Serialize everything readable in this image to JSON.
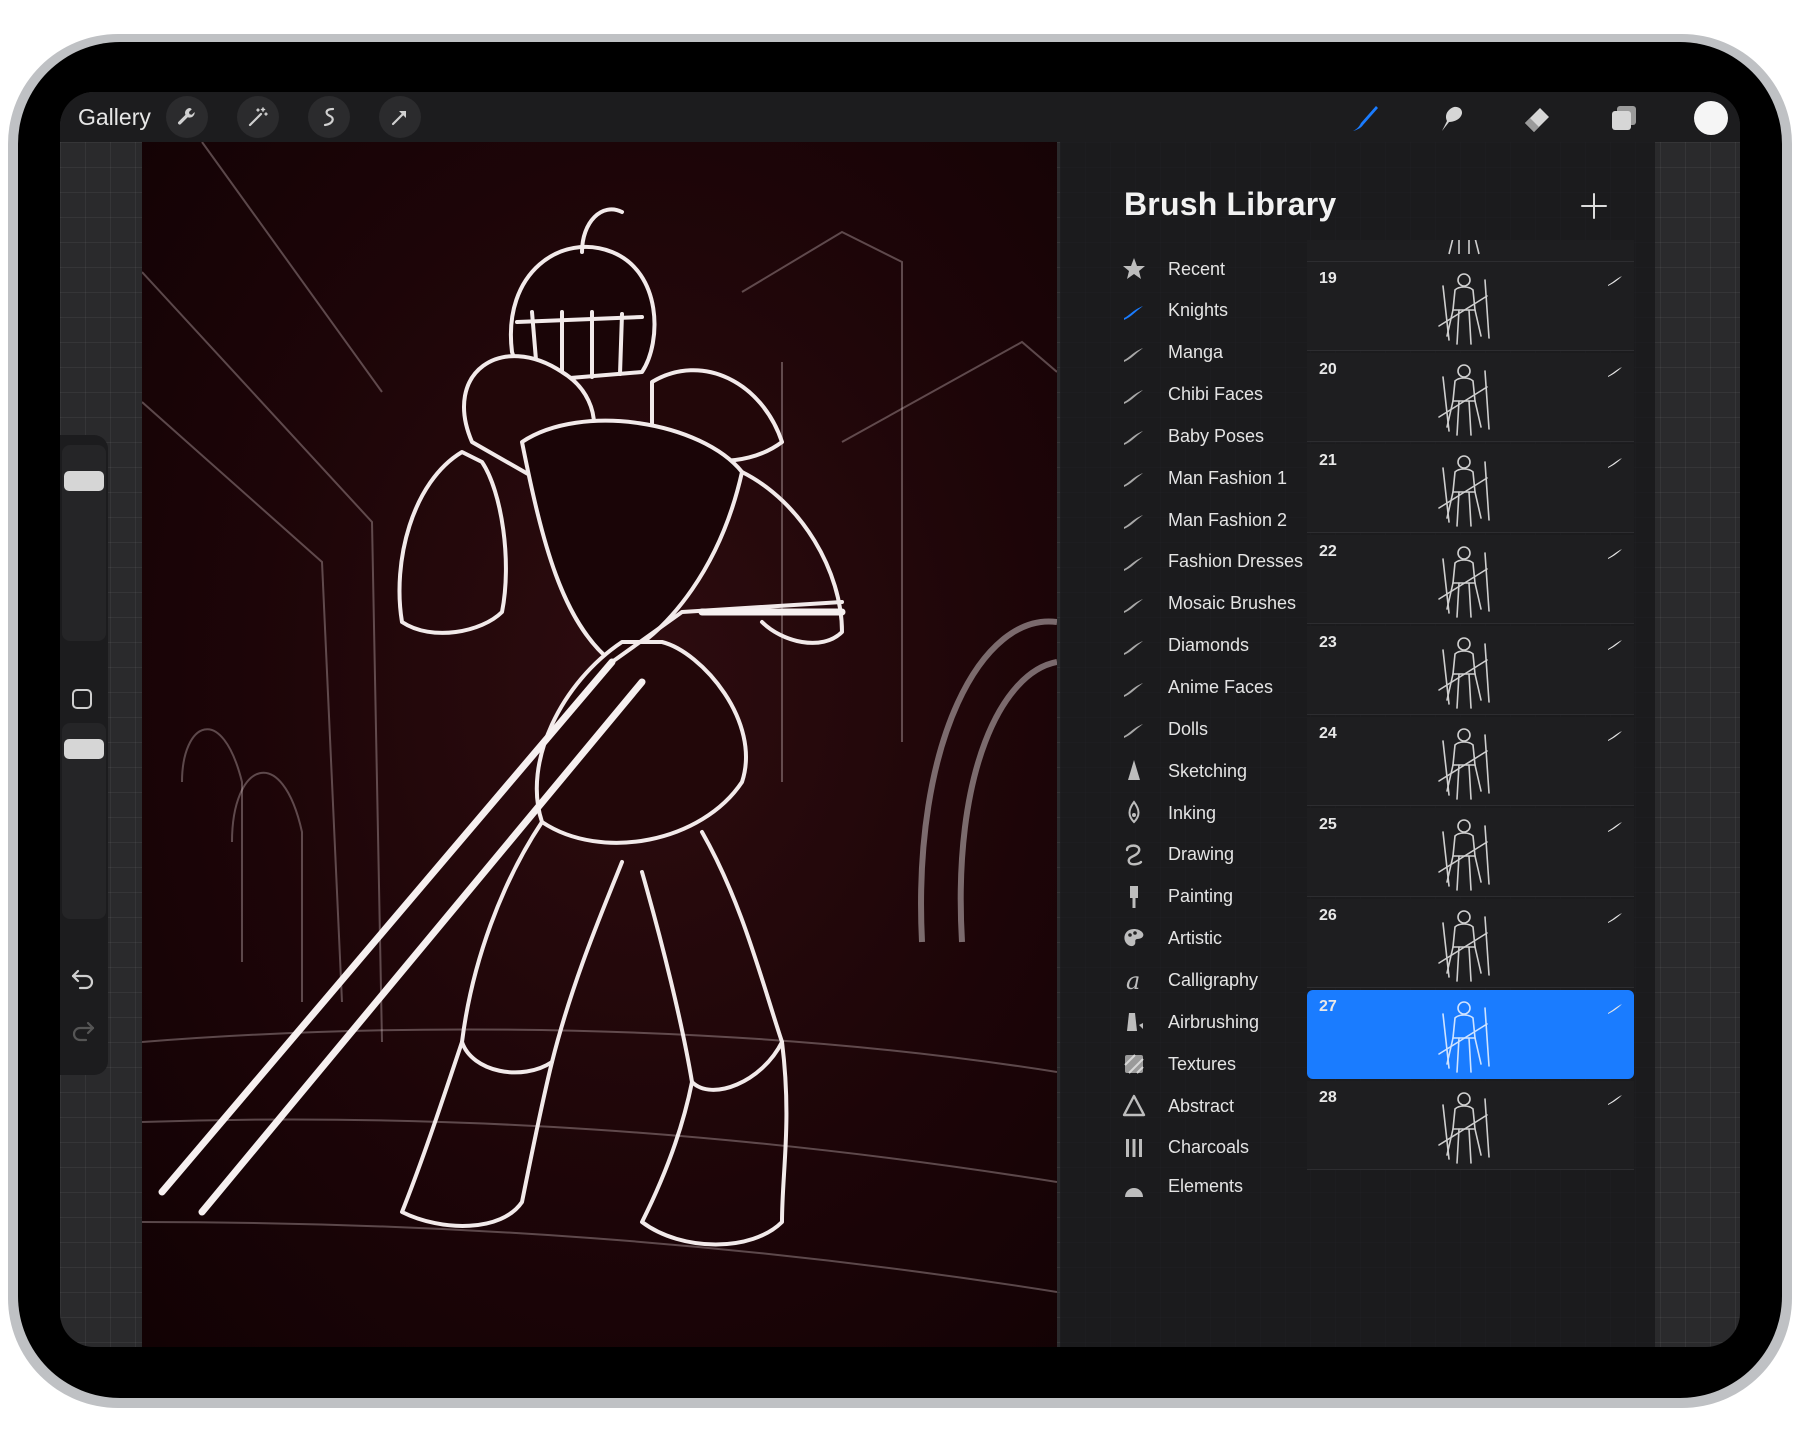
{
  "toolbar": {
    "gallery_label": "Gallery",
    "left_tools": [
      "wrench-icon",
      "magic-wand-icon",
      "selection-icon",
      "transform-arrow-icon"
    ],
    "right_tools": [
      "brush-icon",
      "smudge-icon",
      "eraser-icon",
      "layers-icon"
    ],
    "active_tool": "brush-icon",
    "current_color": "#f5f5f5",
    "accent_color": "#1a7cff"
  },
  "panel": {
    "title": "Brush Library",
    "categories": [
      {
        "label": "Recent",
        "icon": "star-icon"
      },
      {
        "label": "Knights",
        "icon": "stroke-icon"
      },
      {
        "label": "Manga",
        "icon": "stroke-icon"
      },
      {
        "label": "Chibi Faces",
        "icon": "stroke-icon"
      },
      {
        "label": "Baby Poses",
        "icon": "stroke-icon"
      },
      {
        "label": "Man Fashion 1",
        "icon": "stroke-icon"
      },
      {
        "label": "Man Fashion 2",
        "icon": "stroke-icon"
      },
      {
        "label": "Fashion Dresses",
        "icon": "stroke-icon"
      },
      {
        "label": "Mosaic Brushes",
        "icon": "stroke-icon"
      },
      {
        "label": "Diamonds",
        "icon": "stroke-icon"
      },
      {
        "label": "Anime Faces",
        "icon": "stroke-icon"
      },
      {
        "label": "Dolls",
        "icon": "stroke-icon"
      },
      {
        "label": "Sketching",
        "icon": "pencil-tip-icon"
      },
      {
        "label": "Inking",
        "icon": "ink-nib-icon"
      },
      {
        "label": "Drawing",
        "icon": "squiggle-icon"
      },
      {
        "label": "Painting",
        "icon": "paint-brush-icon"
      },
      {
        "label": "Artistic",
        "icon": "palette-icon"
      },
      {
        "label": "Calligraphy",
        "icon": "calligraphy-a-icon"
      },
      {
        "label": "Airbrushing",
        "icon": "airbrush-icon"
      },
      {
        "label": "Textures",
        "icon": "texture-icon"
      },
      {
        "label": "Abstract",
        "icon": "triangle-icon"
      },
      {
        "label": "Charcoals",
        "icon": "charcoal-icon"
      },
      {
        "label": "Elements",
        "icon": "element-icon"
      }
    ],
    "active_category": "Knights",
    "brushes": [
      {
        "num": "19"
      },
      {
        "num": "20"
      },
      {
        "num": "21"
      },
      {
        "num": "22"
      },
      {
        "num": "23"
      },
      {
        "num": "24"
      },
      {
        "num": "25"
      },
      {
        "num": "26"
      },
      {
        "num": "27"
      },
      {
        "num": "28"
      }
    ],
    "selected_brush": "27"
  }
}
